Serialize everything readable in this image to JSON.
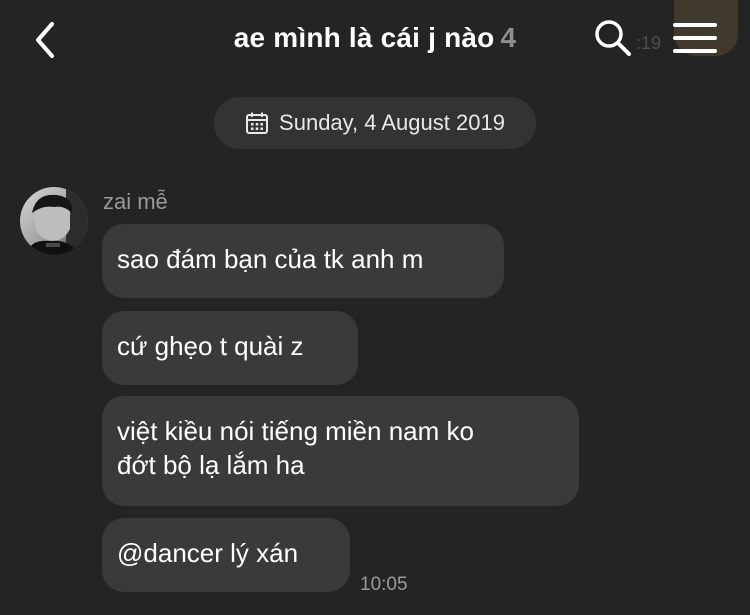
{
  "header": {
    "title": "ae mình là cái j nào",
    "member_count": "4",
    "faded_time": ":19",
    "back_icon": "chevron-left-icon",
    "search_icon": "search-icon",
    "menu_icon": "hamburger-menu-icon"
  },
  "date_separator": {
    "icon": "calendar-icon",
    "label": "Sunday, 4 August 2019"
  },
  "message_group": {
    "sender": "zai mễ",
    "avatar_icon": "profile-photo",
    "messages": [
      {
        "text": "sao đám bạn của tk anh m"
      },
      {
        "text": "cứ ghẹo t quài z"
      },
      {
        "text": "việt kiều nói tiếng miền nam ko\nđớt bộ lạ lắm ha"
      },
      {
        "text": "@dancer lý xán"
      }
    ],
    "time": "10:05"
  },
  "colors": {
    "background": "#242424",
    "bubble": "#3a3a3a",
    "date_pill": "#333333",
    "muted_text": "#9a9a9a",
    "count_text": "#8e8e8e"
  }
}
